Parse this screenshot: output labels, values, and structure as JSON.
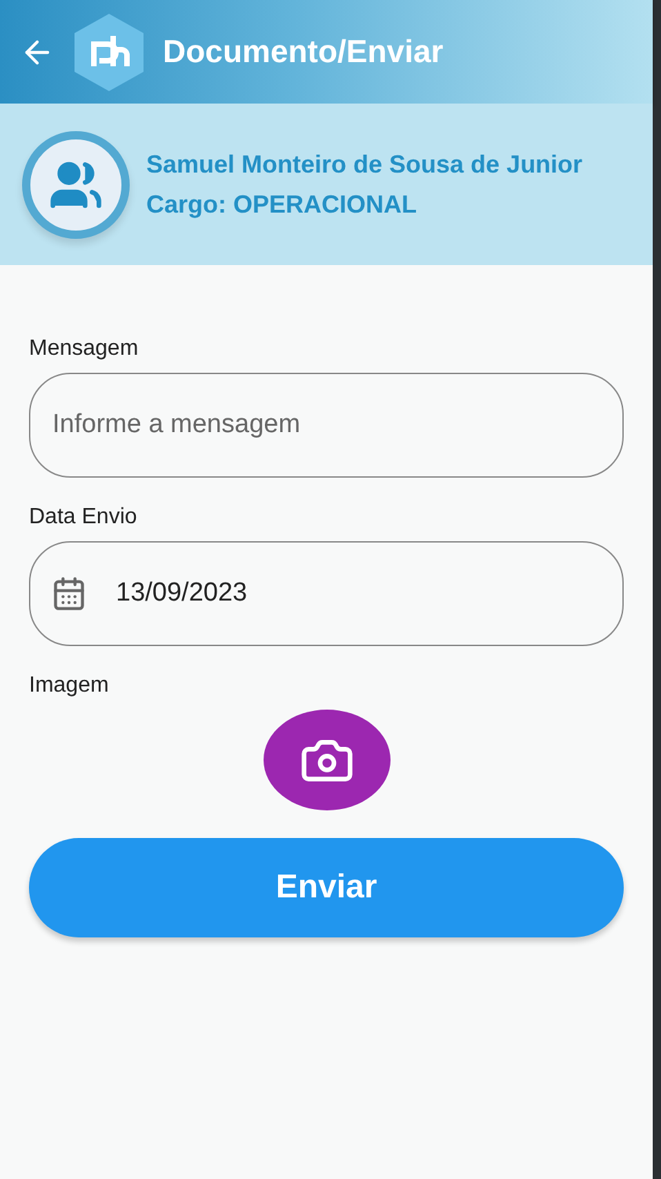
{
  "app_bar": {
    "title": "Documento/Enviar"
  },
  "user": {
    "name": "Samuel Monteiro de Sousa de Junior",
    "role": "Cargo: OPERACIONAL"
  },
  "form": {
    "fields": [
      {
        "kind": "text",
        "label": "Mensagem",
        "placeholder": "Informe a mensagem"
      },
      {
        "kind": "date",
        "label": "Data Envio",
        "value": "13/09/2023"
      }
    ],
    "image": {
      "label": "Imagem"
    },
    "submit": "Enviar"
  }
}
